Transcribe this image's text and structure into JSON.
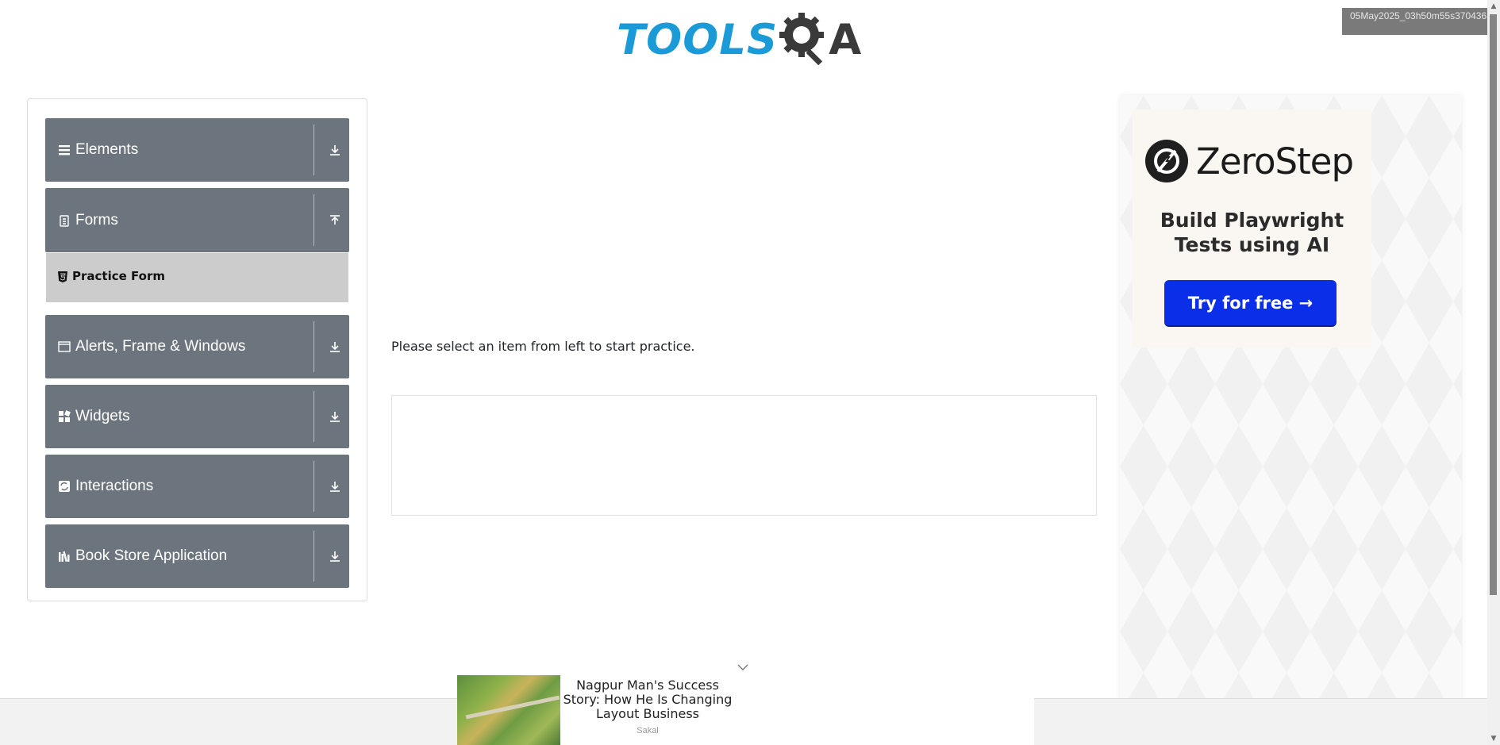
{
  "header": {
    "logo_text": "TOOLS",
    "logo_suffix": "A"
  },
  "overlay": {
    "timestamp": "05May2025_03h50m55s370436"
  },
  "sidebar": {
    "groups": [
      {
        "label": "Elements",
        "icon": "list-icon",
        "arrow": "download-arrow-icon"
      },
      {
        "label": "Forms",
        "icon": "clipboard-icon",
        "arrow": "upload-arrow-icon",
        "expanded": true,
        "items": [
          {
            "label": "Practice Form",
            "icon": "html5-icon"
          }
        ]
      },
      {
        "label": "Alerts, Frame & Windows",
        "icon": "window-icon",
        "arrow": "download-arrow-icon"
      },
      {
        "label": "Widgets",
        "icon": "widgets-icon",
        "arrow": "download-arrow-icon"
      },
      {
        "label": "Interactions",
        "icon": "interactions-icon",
        "arrow": "download-arrow-icon"
      },
      {
        "label": "Book Store Application",
        "icon": "books-icon",
        "arrow": "download-arrow-icon"
      }
    ]
  },
  "main": {
    "prompt": "Please select an item from left to start practice."
  },
  "ad": {
    "brand": "ZeroStep",
    "headline_line1": "Build Playwright",
    "headline_line2": "Tests using AI",
    "cta": "Try for free →",
    "cta_color": "#0b2ee8"
  },
  "bottom_ad": {
    "title": "Nagpur Man's Success Story: How He Is Changing Layout Business",
    "source": "Sakal"
  },
  "colors": {
    "sidebar_group_bg": "#6c757d",
    "sidebar_active_bg": "#cccccc",
    "logo_blue": "#1a9bd7"
  }
}
